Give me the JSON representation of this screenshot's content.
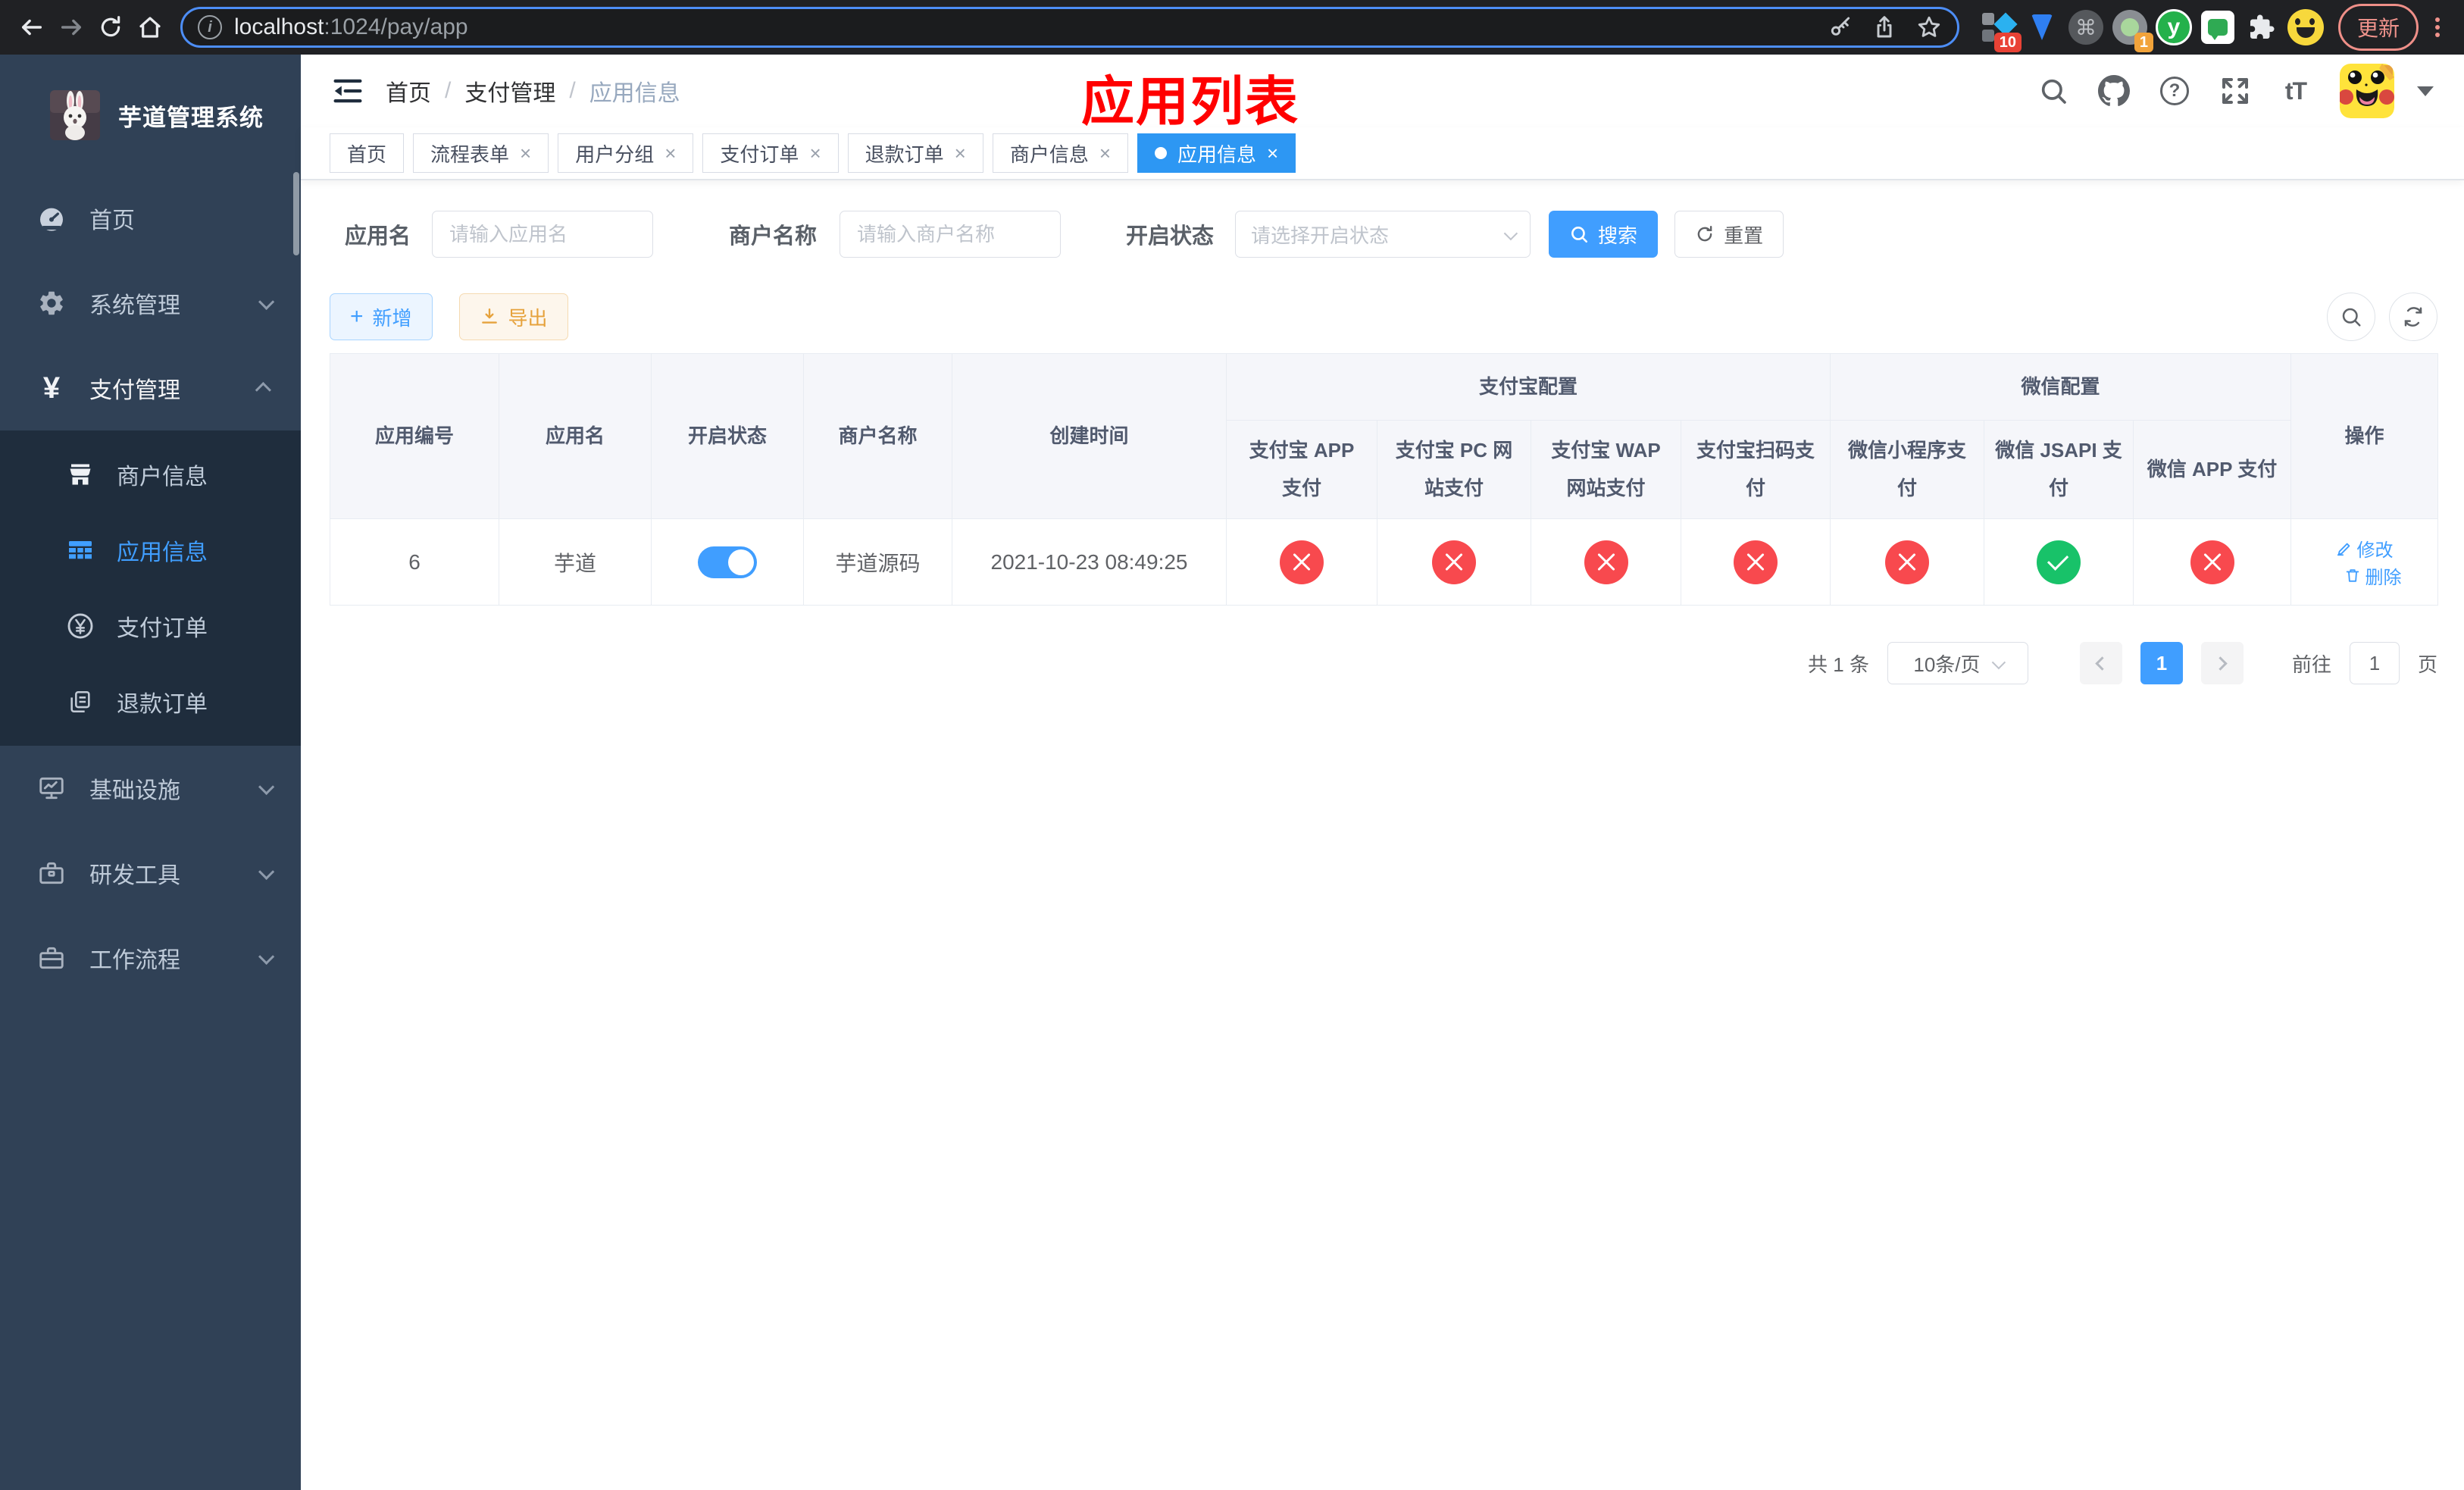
{
  "browser": {
    "url_host": "localhost",
    "url_path": ":1024/pay/app",
    "update_label": "更新",
    "ext_badge_red": "10",
    "ext_badge_orange": "1",
    "ext_letter": "y"
  },
  "icons": {
    "close": "×",
    "slash": "/",
    "help": "?",
    "command": "⌘",
    "font_size": "tT",
    "info": "i",
    "plus": "+",
    "yen": "¥"
  },
  "sidebar": {
    "title": "芋道管理系统",
    "menu": [
      {
        "label": "首页"
      },
      {
        "label": "系统管理"
      },
      {
        "label": "支付管理"
      }
    ],
    "submenu": [
      {
        "label": "商户信息"
      },
      {
        "label": "应用信息",
        "active": true
      },
      {
        "label": "支付订单"
      },
      {
        "label": "退款订单"
      }
    ],
    "menu_bottom": [
      {
        "label": "基础设施"
      },
      {
        "label": "研发工具"
      },
      {
        "label": "工作流程"
      }
    ]
  },
  "header": {
    "breadcrumb": [
      "首页",
      "支付管理",
      "应用信息"
    ],
    "annotation": "应用列表"
  },
  "tabs": [
    {
      "label": "首页",
      "closable": false
    },
    {
      "label": "流程表单",
      "closable": true
    },
    {
      "label": "用户分组",
      "closable": true
    },
    {
      "label": "支付订单",
      "closable": true
    },
    {
      "label": "退款订单",
      "closable": true
    },
    {
      "label": "商户信息",
      "closable": true
    },
    {
      "label": "应用信息",
      "closable": true,
      "active": true
    }
  ],
  "filters": {
    "app_name_label": "应用名",
    "app_name_placeholder": "请输入应用名",
    "merchant_label": "商户名称",
    "merchant_placeholder": "请输入商户名称",
    "status_label": "开启状态",
    "status_placeholder": "请选择开启状态",
    "search_label": "搜索",
    "reset_label": "重置"
  },
  "toolbar": {
    "add_label": "新增",
    "export_label": "导出"
  },
  "table": {
    "main_headers": [
      "应用编号",
      "应用名",
      "开启状态",
      "商户名称",
      "创建时间",
      "操作"
    ],
    "group_headers": [
      "支付宝配置",
      "微信配置"
    ],
    "sub_headers": [
      "支付宝 APP 支付",
      "支付宝 PC 网站支付",
      "支付宝 WAP 网站支付",
      "支付宝扫码支付",
      "微信小程序支付",
      "微信 JSAPI 支付",
      "微信 APP 支付"
    ],
    "row": {
      "id": "6",
      "name": "芋道",
      "enabled": true,
      "merchant_name": "芋道源码",
      "created_at": "2021-10-23 08:49:25",
      "pay_channels": [
        "disabled",
        "disabled",
        "disabled",
        "disabled",
        "disabled",
        "enabled",
        "disabled"
      ],
      "edit_label": "修改",
      "delete_label": "删除"
    }
  },
  "pagination": {
    "total_label": "共 1 条",
    "page_size_label": "10条/页",
    "current_page": "1",
    "goto_label": "前往",
    "goto_value": "1",
    "page_unit_label": "页"
  },
  "colors": {
    "accent": "#409eff",
    "danger": "#f8494e",
    "success": "#18c269",
    "sidebar_bg": "#304156",
    "submenu_bg": "#1f2d3d",
    "annotation": "#ff0000"
  }
}
